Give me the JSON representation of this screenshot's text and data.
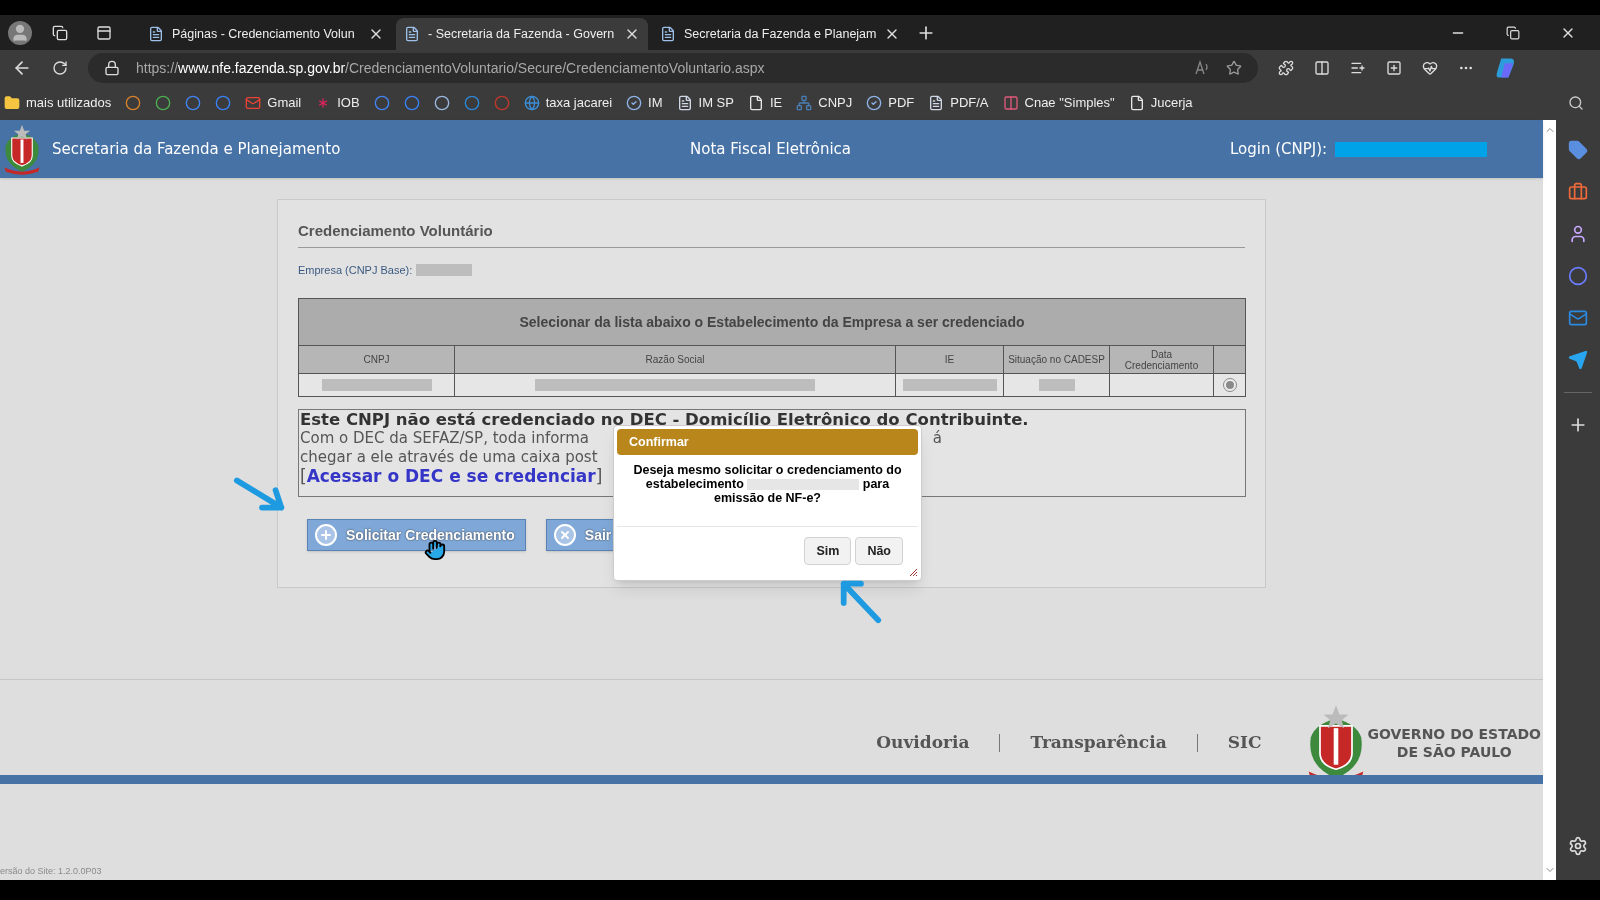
{
  "browser": {
    "tabs": [
      {
        "title": "Páginas - Credenciamento Volun",
        "selected": false
      },
      {
        "title": "- Secretaria da Fazenda - Govern",
        "selected": true
      },
      {
        "title": "Secretaria da Fazenda e Planejam",
        "selected": false
      }
    ],
    "url": {
      "scheme": "https://",
      "host": "www.nfe.fazenda.sp.gov.br",
      "path": "/CredenciamentoVoluntario/Secure/CredenciamentoVoluntario.aspx"
    },
    "bookmarks": [
      {
        "label": "mais utilizados",
        "kind": "folder"
      },
      {
        "label": "Gmail",
        "kind": "mail"
      },
      {
        "label": "IOB",
        "kind": "star"
      },
      {
        "label": "taxa jacarei",
        "kind": "globe"
      },
      {
        "label": "IM",
        "kind": "badge"
      },
      {
        "label": "IM SP",
        "kind": "doc"
      },
      {
        "label": "IE",
        "kind": "page"
      },
      {
        "label": "CNPJ",
        "kind": "tree"
      },
      {
        "label": "PDF",
        "kind": "badge"
      },
      {
        "label": "PDF/A",
        "kind": "doc"
      },
      {
        "label": "Cnae \"Simples\"",
        "kind": "stripes"
      },
      {
        "label": "Jucerja",
        "kind": "page"
      }
    ]
  },
  "header": {
    "agency": "Secretaria da Fazenda e Planejamento",
    "system": "Nota Fiscal Eletrônica",
    "login_label": "Login (CNPJ):"
  },
  "form": {
    "title": "Credenciamento Voluntário",
    "company_label": "Empresa (CNPJ Base):",
    "table": {
      "caption": "Selecionar da lista abaixo o Estabelecimento da Empresa a ser credenciado",
      "columns": [
        "CNPJ",
        "Razão Social",
        "IE",
        "Situação no CADESP",
        "Data Credenciamento"
      ],
      "rows": [
        {
          "selected": true
        }
      ]
    },
    "notice": {
      "heading": "Este CNPJ não está credenciado no DEC - Domicílio Eletrônico do Contribuinte.",
      "line_1": "Com o DEC da SEFAZ/SP, toda informa",
      "line_1_end": "á",
      "line_2": "chegar a ele através de uma caixa post",
      "link_open": "[",
      "link": "Acessar o DEC e se credenciar",
      "link_close": "]"
    },
    "buttons": [
      {
        "label": "Solicitar Credenciamento",
        "kind": "add"
      },
      {
        "label": "Sair",
        "kind": "exit"
      }
    ]
  },
  "dialog": {
    "title": "Confirmar",
    "message_start": "Deseja mesmo solicitar o credenciamento do estabelecimento",
    "message_end": "para emissão de NF-e?",
    "buttons": [
      "Sim",
      "Não"
    ]
  },
  "footer": {
    "links": [
      "Ouvidoria",
      "Transparência",
      "SIC"
    ],
    "logo_lines": [
      "GOVERNO DO ESTADO",
      "DE SÃO PAULO"
    ],
    "version": "ersão do Site: 1.2.0.0P03"
  }
}
